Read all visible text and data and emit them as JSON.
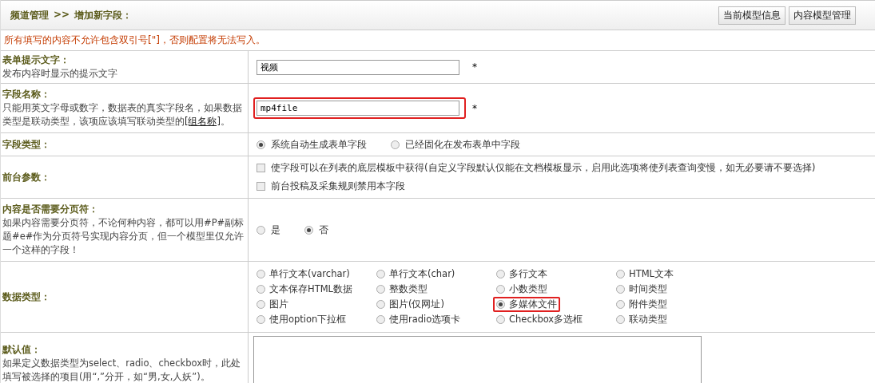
{
  "header": {
    "breadcrumb": [
      "频道管理",
      ">>",
      "增加新字段："
    ],
    "buttons": [
      "当前模型信息",
      "内容模型管理"
    ]
  },
  "warning": "所有填写的内容不允许包含双引号[\"]，否则配置将无法写入。",
  "rows": [
    {
      "kind": "text",
      "label": "表单提示文字：",
      "hint": "发布内容时显示的提示文字",
      "value": "视频",
      "required": "*",
      "highlighted": false
    },
    {
      "kind": "text",
      "label": "字段名称：",
      "hint": "只能用英文字母或数字，数据表的真实字段名，如果数据类型是联动类型，该项应该填写联动类型的",
      "hint_link": "[组名称]",
      "hint_end": "。",
      "value": "mp4file",
      "required": "*",
      "highlighted": true
    },
    {
      "kind": "radio",
      "label": "字段类型：",
      "options": [
        {
          "label": "系统自动生成表单字段",
          "selected": true,
          "highlighted": false
        },
        {
          "label": "已经固化在发布表单中字段",
          "selected": false,
          "highlighted": false
        }
      ]
    },
    {
      "kind": "checks",
      "label": "前台参数：",
      "options": [
        {
          "label": "使字段可以在列表的底层模板中获得(自定义字段默认仅能在文档模板显示，启用此选项将使列表查询变慢，如无必要请不要选择)",
          "checked": false
        },
        {
          "label": "前台投稿及采集规则禁用本字段",
          "checked": false
        }
      ]
    },
    {
      "kind": "radio",
      "label": "内容是否需要分页符：",
      "hint": "如果内容需要分页符，不论何种内容，都可以用#P#副标题#e#作为分页符号实现内容分页，但一个模型里仅允许一个这样的字段！",
      "options": [
        {
          "label": "是",
          "selected": false,
          "highlighted": false
        },
        {
          "label": "否",
          "selected": true,
          "highlighted": false
        }
      ]
    },
    {
      "kind": "grid",
      "label": "数据类型：",
      "options": [
        {
          "label": "单行文本(varchar)",
          "selected": false,
          "highlighted": false
        },
        {
          "label": "单行文本(char)",
          "selected": false,
          "highlighted": false
        },
        {
          "label": "多行文本",
          "selected": false,
          "highlighted": false
        },
        {
          "label": "HTML文本",
          "selected": false,
          "highlighted": false
        },
        {
          "label": "文本保存HTML数据",
          "selected": false,
          "highlighted": false
        },
        {
          "label": "整数类型",
          "selected": false,
          "highlighted": false
        },
        {
          "label": "小数类型",
          "selected": false,
          "highlighted": false
        },
        {
          "label": "时间类型",
          "selected": false,
          "highlighted": false
        },
        {
          "label": "图片",
          "selected": false,
          "highlighted": false
        },
        {
          "label": "图片(仅网址)",
          "selected": false,
          "highlighted": false
        },
        {
          "label": "多媒体文件",
          "selected": true,
          "highlighted": true
        },
        {
          "label": "附件类型",
          "selected": false,
          "highlighted": false
        },
        {
          "label": "使用option下拉框",
          "selected": false,
          "highlighted": false
        },
        {
          "label": "使用radio选项卡",
          "selected": false,
          "highlighted": false
        },
        {
          "label": "Checkbox多选框",
          "selected": false,
          "highlighted": false
        },
        {
          "label": "联动类型",
          "selected": false,
          "highlighted": false
        }
      ]
    },
    {
      "kind": "textarea",
      "label": "默认值：",
      "hint": "如果定义数据类型为select、radio、checkbox时，此处填写被选择的项目(用“,”分开，如“男,女,人妖”)。"
    }
  ]
}
